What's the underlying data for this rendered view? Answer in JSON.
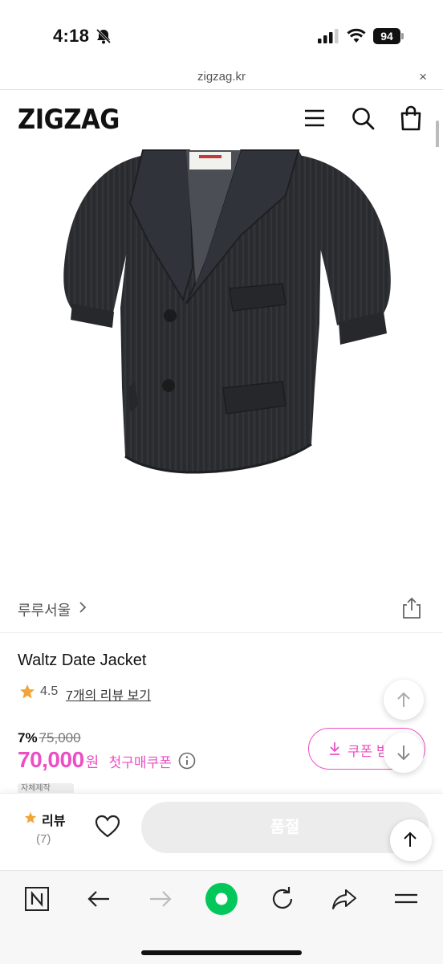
{
  "status_bar": {
    "time": "4:18",
    "battery": "94",
    "icons": [
      "bell-slash-icon",
      "signal-icon",
      "wifi-icon",
      "battery-icon"
    ]
  },
  "url_bar": {
    "url": "zigzag.kr",
    "close_label": "×"
  },
  "header": {
    "logo": "ZIGZAG",
    "icons": [
      "menu-icon",
      "search-icon",
      "cart-icon"
    ]
  },
  "brand": {
    "name": "루루서울",
    "chevron": "chevron-right-icon",
    "share": "share-icon"
  },
  "product": {
    "title": "Waltz Date Jacket",
    "rating": "4.5",
    "review_link": "7개의 리뷰 보기",
    "discount": "7%",
    "original_price": "75,000",
    "price": "70,000",
    "price_unit": "원",
    "coupon_label": "첫구매쿠폰",
    "coupon_button": "쿠폰 받",
    "tag": "자체제작"
  },
  "purchase_bar": {
    "review_label": "리뷰",
    "review_count": "(7)",
    "soldout_label": "품절"
  },
  "colors": {
    "accent_pink": "#ec4fc4",
    "rating_star": "#f2a33a",
    "naver_green": "#03c75a"
  },
  "browser_toolbar": {
    "icons": [
      "naver-n-icon",
      "back-arrow-icon",
      "forward-arrow-icon",
      "naver-home-icon",
      "reload-icon",
      "share-arrow-icon",
      "menu-lines-icon"
    ]
  }
}
